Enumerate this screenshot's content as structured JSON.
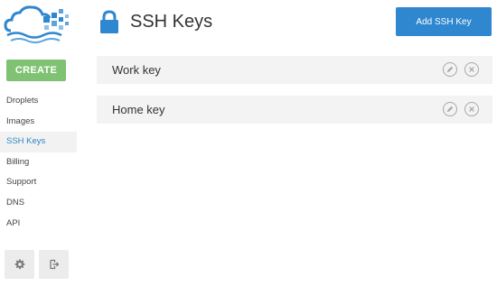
{
  "sidebar": {
    "create_label": "CREATE",
    "items": [
      {
        "label": "Droplets",
        "active": false
      },
      {
        "label": "Images",
        "active": false
      },
      {
        "label": "SSH Keys",
        "active": true
      },
      {
        "label": "Billing",
        "active": false
      },
      {
        "label": "Support",
        "active": false
      },
      {
        "label": "DNS",
        "active": false
      },
      {
        "label": "API",
        "active": false
      }
    ],
    "bottom_icons": [
      "gear-icon",
      "logout-icon"
    ]
  },
  "header": {
    "title": "SSH Keys",
    "icon": "lock-icon",
    "add_button_label": "Add SSH Key"
  },
  "keys": [
    {
      "name": "Work key",
      "actions": [
        "edit-icon",
        "delete-icon"
      ]
    },
    {
      "name": "Home key",
      "actions": [
        "edit-icon",
        "delete-icon"
      ]
    }
  ],
  "colors": {
    "accent": "#2f87cf",
    "create": "#7fc273",
    "active_nav_text": "#2d86c8",
    "row_bg": "#f3f3f3"
  }
}
